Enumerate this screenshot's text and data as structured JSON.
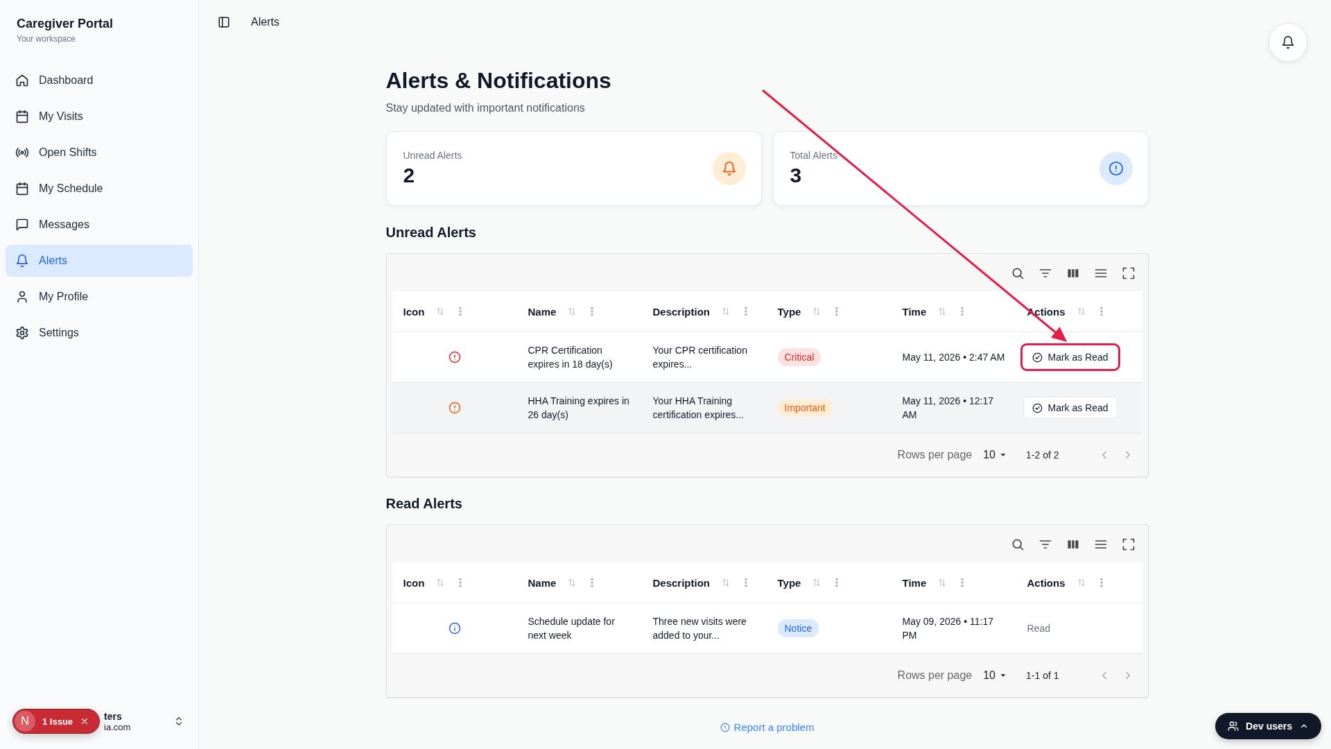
{
  "sidebar": {
    "title": "Caregiver Portal",
    "subtitle": "Your workspace",
    "items": [
      {
        "label": "Dashboard",
        "kind": "home",
        "selected": false
      },
      {
        "label": "My Visits",
        "kind": "calendar",
        "selected": false
      },
      {
        "label": "Open Shifts",
        "kind": "broadcast",
        "selected": false
      },
      {
        "label": "My Schedule",
        "kind": "calendar",
        "selected": false
      },
      {
        "label": "Messages",
        "kind": "message",
        "selected": false
      },
      {
        "label": "Alerts",
        "kind": "bell",
        "selected": true
      },
      {
        "label": "My Profile",
        "kind": "user",
        "selected": false
      },
      {
        "label": "Settings",
        "kind": "gear",
        "selected": false
      }
    ],
    "issue_badge": {
      "avatar": "N",
      "label": "1 Issue"
    },
    "user": {
      "name": "ters",
      "email": "ia.com"
    }
  },
  "header": {
    "breadcrumb": "Alerts"
  },
  "page": {
    "title": "Alerts & Notifications",
    "subtitle": "Stay updated with important notifications"
  },
  "stats": [
    {
      "label": "Unread Alerts",
      "value": "2",
      "kind": "unread"
    },
    {
      "label": "Total Alerts",
      "value": "3",
      "kind": "total"
    }
  ],
  "sections": [
    {
      "title": "Unread Alerts",
      "columns": [
        "Icon",
        "Name",
        "Description",
        "Type",
        "Time",
        "Actions"
      ],
      "rows": [
        {
          "hovered": false,
          "name": "CPR Certification expires in 18 day(s)",
          "description": "Your CPR certification expires...",
          "type": {
            "label": "Critical",
            "kind": "critical"
          },
          "time": "May 11, 2026 • 2:47 AM",
          "action": {
            "kind": "button",
            "label": "Mark as Read",
            "highlighted": true
          }
        },
        {
          "hovered": true,
          "name": "HHA Training expires in 26 day(s)",
          "description": "Your HHA Training certification expires...",
          "type": {
            "label": "Important",
            "kind": "important"
          },
          "time": "May 11, 2026 • 12:17 AM",
          "action": {
            "kind": "button",
            "label": "Mark as Read",
            "highlighted": false
          }
        }
      ],
      "pagination": {
        "rows_label": "Rows per page",
        "rows_value": "10",
        "range": "1-2 of 2"
      }
    },
    {
      "title": "Read Alerts",
      "columns": [
        "Icon",
        "Name",
        "Description",
        "Type",
        "Time",
        "Actions"
      ],
      "rows": [
        {
          "hovered": false,
          "name": "Schedule update for next week",
          "description": "Three new visits were added to your...",
          "type": {
            "label": "Notice",
            "kind": "notice"
          },
          "time": "May 09, 2026 • 11:17 PM",
          "action": {
            "kind": "text",
            "label": "Read"
          }
        }
      ],
      "pagination": {
        "rows_label": "Rows per page",
        "rows_value": "10",
        "range": "1-1 of 1"
      }
    }
  ],
  "report_link": "Report a problem",
  "dev_users": "Dev users"
}
